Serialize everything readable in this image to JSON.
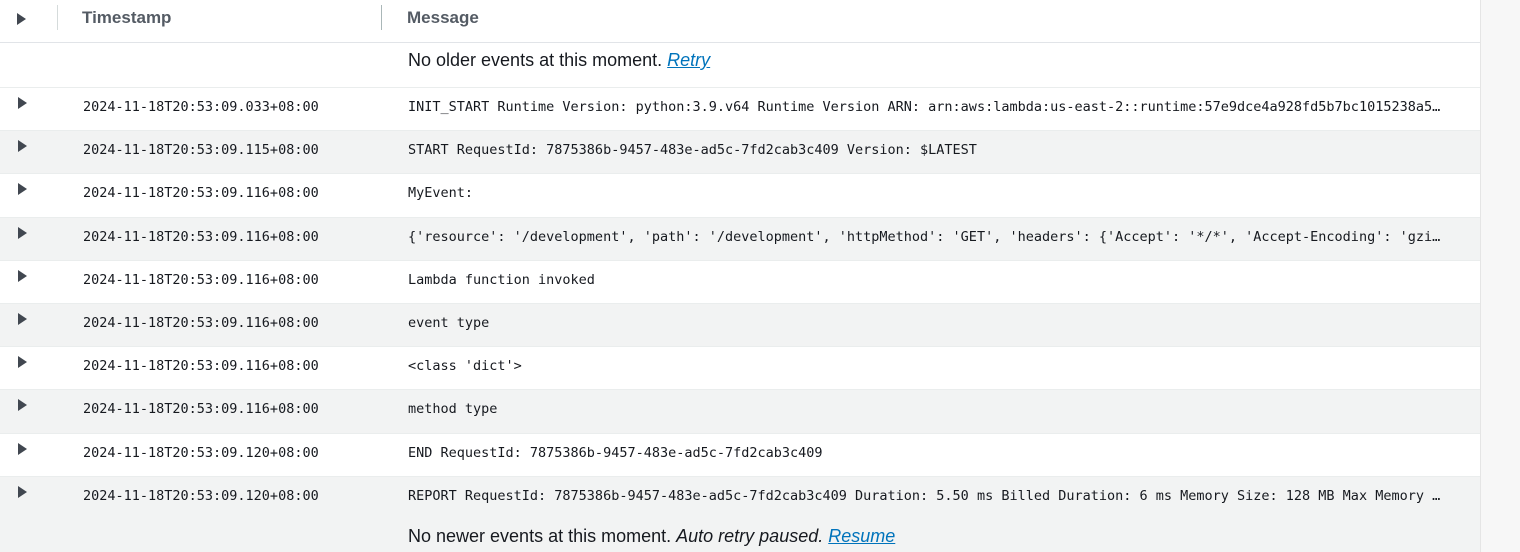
{
  "columns": {
    "timestamp": "Timestamp",
    "message": "Message"
  },
  "top_status": {
    "text": "No older events at this moment.",
    "retry_link": "Retry"
  },
  "events": [
    {
      "timestamp": "2024-11-18T20:53:09.033+08:00",
      "message": "INIT_START Runtime Version: python:3.9.v64 Runtime Version ARN: arn:aws:lambda:us-east-2::runtime:57e9dce4a928fd5b7bc1015238a5…"
    },
    {
      "timestamp": "2024-11-18T20:53:09.115+08:00",
      "message": "START RequestId: 7875386b-9457-483e-ad5c-7fd2cab3c409 Version: $LATEST"
    },
    {
      "timestamp": "2024-11-18T20:53:09.116+08:00",
      "message": "MyEvent:"
    },
    {
      "timestamp": "2024-11-18T20:53:09.116+08:00",
      "message": "{'resource': '/development', 'path': '/development', 'httpMethod': 'GET', 'headers': {'Accept': '*/*', 'Accept-Encoding': 'gzi…"
    },
    {
      "timestamp": "2024-11-18T20:53:09.116+08:00",
      "message": "Lambda function invoked"
    },
    {
      "timestamp": "2024-11-18T20:53:09.116+08:00",
      "message": "event type"
    },
    {
      "timestamp": "2024-11-18T20:53:09.116+08:00",
      "message": "<class 'dict'>"
    },
    {
      "timestamp": "2024-11-18T20:53:09.116+08:00",
      "message": "method type"
    },
    {
      "timestamp": "2024-11-18T20:53:09.120+08:00",
      "message": "END RequestId: 7875386b-9457-483e-ad5c-7fd2cab3c409"
    },
    {
      "timestamp": "2024-11-18T20:53:09.120+08:00",
      "message": "REPORT RequestId: 7875386b-9457-483e-ad5c-7fd2cab3c409 Duration: 5.50 ms Billed Duration: 6 ms Memory Size: 128 MB Max Memory …"
    }
  ],
  "bottom_status": {
    "text": "No newer events at this moment.",
    "paused_text": "Auto retry paused.",
    "resume_link": "Resume"
  },
  "colors": {
    "link": "#0073bb",
    "alt_row": "#f2f3f3",
    "header_text": "#545b64"
  }
}
